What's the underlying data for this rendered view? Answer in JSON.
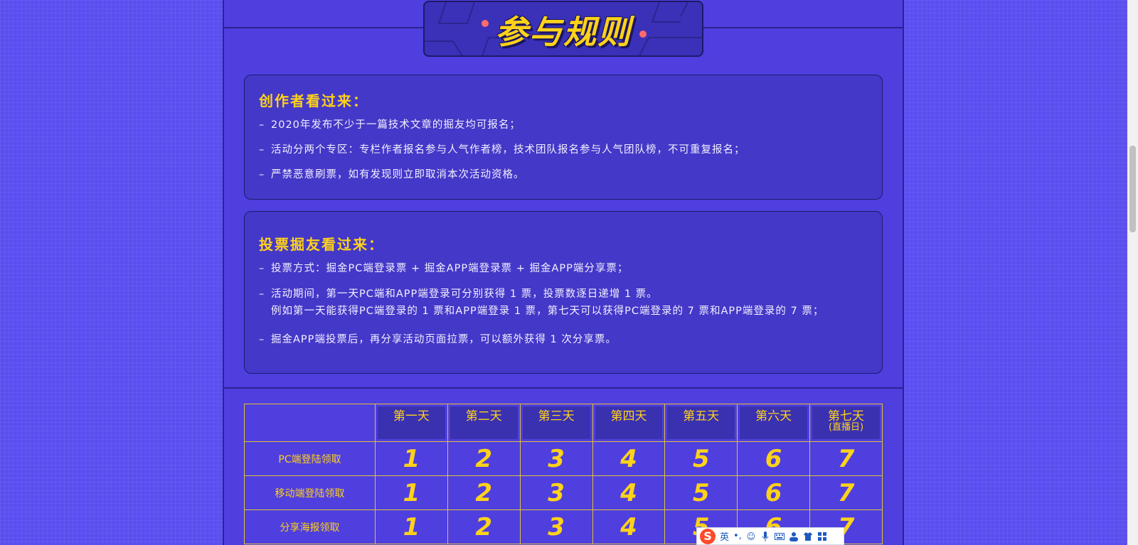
{
  "header": {
    "title": "参与规则"
  },
  "creators": {
    "heading": "创作者看过来：",
    "rules": [
      "2020年发布不少于一篇技术文章的掘友均可报名；",
      "活动分两个专区：专栏作者报名参与人气作者榜，技术团队报名参与人气团队榜，不可重复报名；",
      "严禁恶意刷票，如有发现则立即取消本次活动资格。"
    ]
  },
  "voters": {
    "heading": "投票掘友看过来：",
    "rule1": "投票方式：掘金PC端登录票 + 掘金APP端登录票 + 掘金APP端分享票；",
    "rule2_line1": "活动期间，第一天PC端和APP端登录可分别获得 1 票，投票数逐日递增 1 票。",
    "rule2_line2": "例如第一天能获得PC端登录的 1 票和APP端登录 1 票，第七天可以获得PC端登录的 7 票和APP端登录的 7 票；",
    "rule3": "掘金APP端投票后，再分享活动页面拉票，可以额外获得 1 次分享票。"
  },
  "table": {
    "days": [
      "第一天",
      "第二天",
      "第三天",
      "第四天",
      "第五天",
      "第六天",
      "第七天"
    ],
    "last_day_note": "(直播日)",
    "rows": [
      {
        "label": "PC端登陆领取",
        "values": [
          "1",
          "2",
          "3",
          "4",
          "5",
          "6",
          "7"
        ]
      },
      {
        "label": "移动端登陆领取",
        "values": [
          "1",
          "2",
          "3",
          "4",
          "5",
          "6",
          "7"
        ]
      },
      {
        "label": "分享海报领取",
        "values": [
          "1",
          "2",
          "3",
          "4",
          "5",
          "6",
          "7"
        ]
      }
    ]
  },
  "ime": {
    "logo": "S",
    "mode": "英",
    "punct": "•,"
  },
  "colors": {
    "accent": "#ffd21a",
    "panel": "#4f3fde",
    "background": "#5a4ef0",
    "border": "#2b2292"
  }
}
